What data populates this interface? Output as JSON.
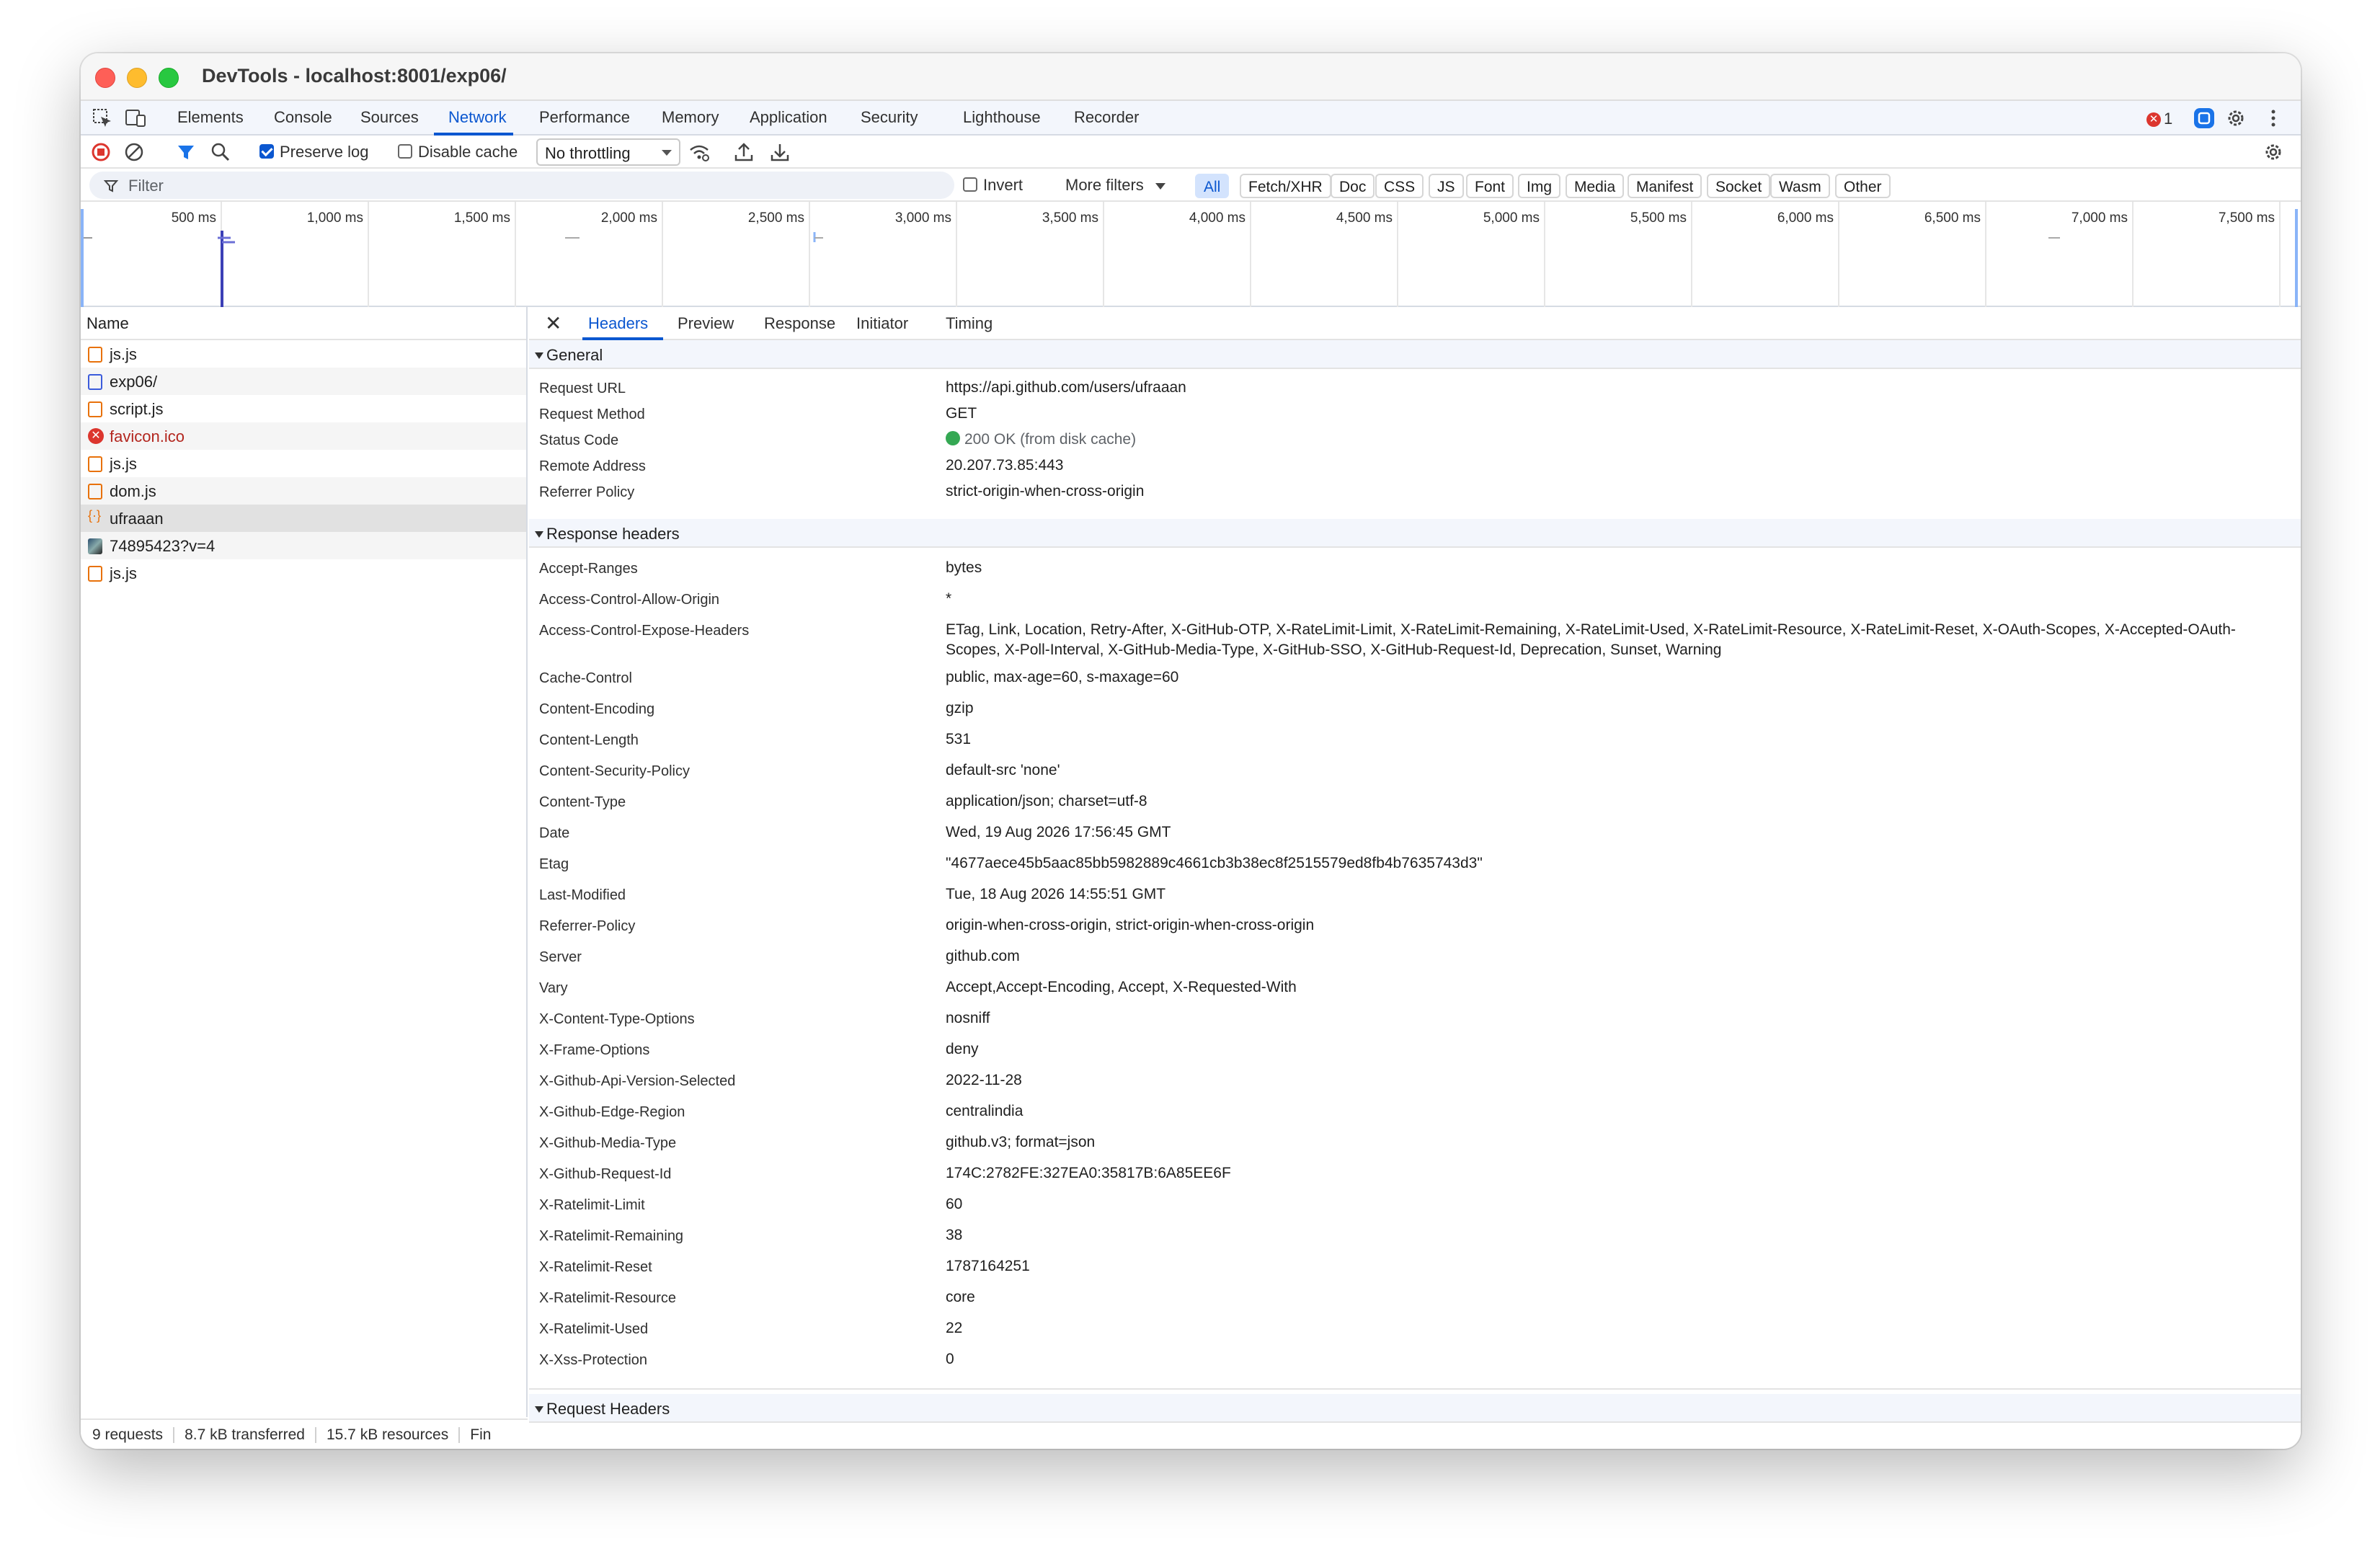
{
  "window": {
    "title": "DevTools - localhost:8001/exp06/"
  },
  "tabs": [
    "Elements",
    "Console",
    "Sources",
    "Network",
    "Performance",
    "Memory",
    "Application",
    "Security",
    "Lighthouse",
    "Recorder"
  ],
  "active_tab": "Network",
  "error_count": "1",
  "toolbar": {
    "preserve_log": "Preserve log",
    "disable_cache": "Disable cache",
    "throttling": "No throttling"
  },
  "filter": {
    "placeholder": "Filter",
    "invert": "Invert",
    "more_filters": "More filters",
    "types": [
      "All",
      "Fetch/XHR",
      "Doc",
      "CSS",
      "JS",
      "Font",
      "Img",
      "Media",
      "Manifest",
      "Socket",
      "Wasm",
      "Other"
    ]
  },
  "overview": {
    "ticks": [
      "500 ms",
      "1,000 ms",
      "1,500 ms",
      "2,000 ms",
      "2,500 ms",
      "3,000 ms",
      "3,500 ms",
      "4,000 ms",
      "4,500 ms",
      "5,000 ms",
      "5,500 ms",
      "6,000 ms",
      "6,500 ms",
      "7,000 ms",
      "7,500 ms"
    ]
  },
  "list": {
    "header": "Name",
    "rows": [
      {
        "name": "js.js",
        "kind": "script"
      },
      {
        "name": "exp06/",
        "kind": "document"
      },
      {
        "name": "script.js",
        "kind": "script"
      },
      {
        "name": "favicon.ico",
        "kind": "error"
      },
      {
        "name": "js.js",
        "kind": "script"
      },
      {
        "name": "dom.js",
        "kind": "script"
      },
      {
        "name": "ufraaan",
        "kind": "json"
      },
      {
        "name": "74895423?v=4",
        "kind": "image"
      },
      {
        "name": "js.js",
        "kind": "script"
      }
    ],
    "footer": {
      "requests": "9 requests",
      "transferred": "8.7 kB transferred",
      "resources": "15.7 kB resources",
      "finish": "Fin"
    }
  },
  "details": {
    "tabs": [
      "Headers",
      "Preview",
      "Response",
      "Initiator",
      "Timing"
    ],
    "active_tab": "Headers",
    "general_title": "General",
    "general": [
      {
        "key": "Request URL",
        "value": "https://api.github.com/users/ufraaan"
      },
      {
        "key": "Request Method",
        "value": "GET"
      },
      {
        "key": "Status Code",
        "value": "200 OK",
        "note": "(from disk cache)"
      },
      {
        "key": "Remote Address",
        "value": "20.207.73.85:443"
      },
      {
        "key": "Referrer Policy",
        "value": "strict-origin-when-cross-origin"
      }
    ],
    "response_title": "Response headers",
    "response": [
      {
        "key": "Accept-Ranges",
        "value": "bytes"
      },
      {
        "key": "Access-Control-Allow-Origin",
        "value": "*"
      },
      {
        "key": "Access-Control-Expose-Headers",
        "value": "ETag, Link, Location, Retry-After, X-GitHub-OTP, X-RateLimit-Limit, X-RateLimit-Remaining, X-RateLimit-Used, X-RateLimit-Resource, X-RateLimit-Reset, X-OAuth-Scopes, X-Accepted-OAuth-Scopes, X-Poll-Interval, X-GitHub-Media-Type, X-GitHub-SSO, X-GitHub-Request-Id, Deprecation, Sunset, Warning"
      },
      {
        "key": "Cache-Control",
        "value": "public, max-age=60, s-maxage=60"
      },
      {
        "key": "Content-Encoding",
        "value": "gzip"
      },
      {
        "key": "Content-Length",
        "value": "531"
      },
      {
        "key": "Content-Security-Policy",
        "value": "default-src 'none'"
      },
      {
        "key": "Content-Type",
        "value": "application/json; charset=utf-8"
      },
      {
        "key": "Date",
        "value": "Wed, 19 Aug 2026 17:56:45 GMT"
      },
      {
        "key": "Etag",
        "value": "\"4677aece45b5aac85bb5982889c4661cb3b38ec8f2515579ed8fb4b7635743d3\""
      },
      {
        "key": "Last-Modified",
        "value": "Tue, 18 Aug 2026 14:55:51 GMT"
      },
      {
        "key": "Referrer-Policy",
        "value": "origin-when-cross-origin, strict-origin-when-cross-origin"
      },
      {
        "key": "Server",
        "value": "github.com"
      },
      {
        "key": "Vary",
        "value": "Accept,Accept-Encoding, Accept, X-Requested-With"
      },
      {
        "key": "X-Content-Type-Options",
        "value": "nosniff"
      },
      {
        "key": "X-Frame-Options",
        "value": "deny"
      },
      {
        "key": "X-Github-Api-Version-Selected",
        "value": "2022-11-28"
      },
      {
        "key": "X-Github-Edge-Region",
        "value": "centralindia"
      },
      {
        "key": "X-Github-Media-Type",
        "value": "github.v3; format=json"
      },
      {
        "key": "X-Github-Request-Id",
        "value": "174C:2782FE:327EA0:35817B:6A85EE6F"
      },
      {
        "key": "X-Ratelimit-Limit",
        "value": "60"
      },
      {
        "key": "X-Ratelimit-Remaining",
        "value": "38"
      },
      {
        "key": "X-Ratelimit-Reset",
        "value": "1787164251"
      },
      {
        "key": "X-Ratelimit-Resource",
        "value": "core"
      },
      {
        "key": "X-Ratelimit-Used",
        "value": "22"
      },
      {
        "key": "X-Xss-Protection",
        "value": "0"
      }
    ],
    "request_title": "Request Headers"
  }
}
